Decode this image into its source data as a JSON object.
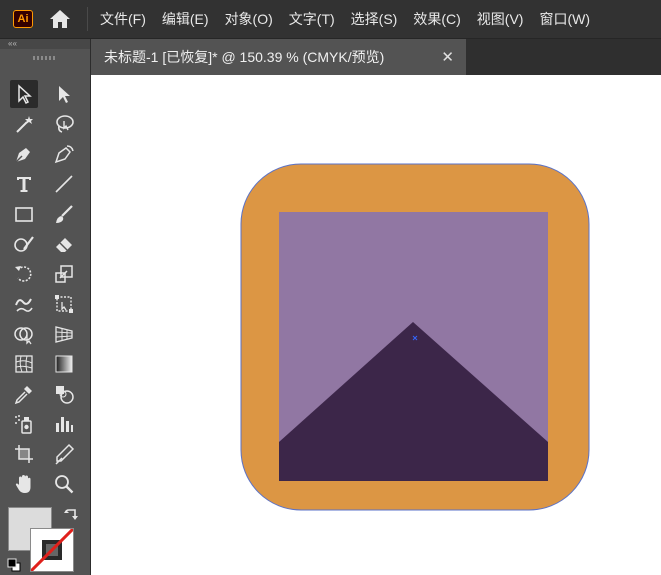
{
  "app": {
    "logo_text": "Ai",
    "icon_home": "home-icon"
  },
  "menu": [
    "文件(F)",
    "编辑(E)",
    "对象(O)",
    "文字(T)",
    "选择(S)",
    "效果(C)",
    "视图(V)",
    "窗口(W)"
  ],
  "toolbar": {
    "collapse_label": "««",
    "tools": [
      {
        "name": "selection-tool-icon",
        "active": true
      },
      {
        "name": "direct-selection-tool-icon",
        "active": false
      },
      {
        "name": "magic-wand-tool-icon",
        "active": false
      },
      {
        "name": "lasso-tool-icon",
        "active": false
      },
      {
        "name": "pen-tool-icon",
        "active": false
      },
      {
        "name": "curvature-tool-icon",
        "active": false
      },
      {
        "name": "type-tool-icon",
        "active": false
      },
      {
        "name": "line-segment-tool-icon",
        "active": false
      },
      {
        "name": "rectangle-tool-icon",
        "active": false
      },
      {
        "name": "paintbrush-tool-icon",
        "active": false
      },
      {
        "name": "shaper-tool-icon",
        "active": false
      },
      {
        "name": "eraser-tool-icon",
        "active": false
      },
      {
        "name": "rotate-tool-icon",
        "active": false
      },
      {
        "name": "scale-tool-icon",
        "active": false
      },
      {
        "name": "warp-tool-icon",
        "active": false
      },
      {
        "name": "free-transform-tool-icon",
        "active": false
      },
      {
        "name": "shape-builder-tool-icon",
        "active": false
      },
      {
        "name": "perspective-grid-tool-icon",
        "active": false
      },
      {
        "name": "mesh-tool-icon",
        "active": false
      },
      {
        "name": "gradient-tool-icon",
        "active": false
      },
      {
        "name": "eyedropper-tool-icon",
        "active": false
      },
      {
        "name": "blend-tool-icon",
        "active": false
      },
      {
        "name": "symbol-sprayer-tool-icon",
        "active": false
      },
      {
        "name": "column-graph-tool-icon",
        "active": false
      },
      {
        "name": "artboard-tool-icon",
        "active": false
      },
      {
        "name": "slice-tool-icon",
        "active": false
      },
      {
        "name": "hand-tool-icon",
        "active": false
      },
      {
        "name": "zoom-tool-icon",
        "active": false
      }
    ]
  },
  "document_tab": {
    "title": "未标题-1 [已恢复]* @ 150.39 % (CMYK/预览)",
    "close_label": "✕"
  },
  "artwork": {
    "colors": {
      "rounded_square_fill": "#dc9644",
      "rounded_square_stroke": "#5a72c8",
      "inner_square_fill": "#9177a3",
      "mountain_fill": "#3c2649",
      "center_marker": "#3366ff"
    }
  },
  "swatches": {
    "fill_color": "#dcdcdc",
    "stroke_color": "none",
    "swap_icon": "swap-arrow-icon",
    "default_icon": "default-colors-icon"
  }
}
